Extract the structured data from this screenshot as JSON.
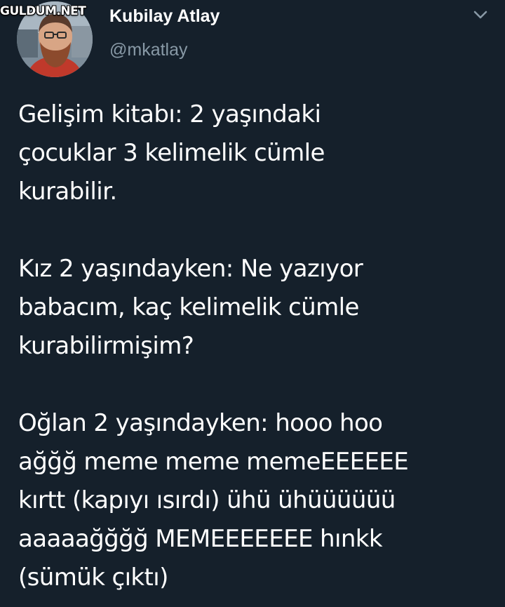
{
  "watermark": {
    "text": "GULDUM.NET"
  },
  "tweet": {
    "avatar_icon": "user-avatar-photo",
    "display_name": "Kubilay Atlay",
    "handle": "@mkatlay",
    "menu_icon": "chevron-down-icon",
    "paragraphs": [
      "Gelişim kitabı: 2 yaşındaki\nçocuklar 3 kelimelik cümle\nkurabilir.",
      "Kız 2 yaşındayken: Ne yazıyor\nbabacım, kaç kelimelik cümle\nkurabilirmişim?",
      "Oğlan 2 yaşındayken: hooo hoo\nağğğ meme meme memeEEEEEE\nkırtt (kapıyı ısırdı) ühü ühüüüüüü\naaaaağğğğ MEMEEEEEEE hınkk\n(sümük çıktı)"
    ]
  },
  "colors": {
    "background": "#15202b",
    "text": "#ffffff",
    "secondary_text": "#8899a6"
  }
}
